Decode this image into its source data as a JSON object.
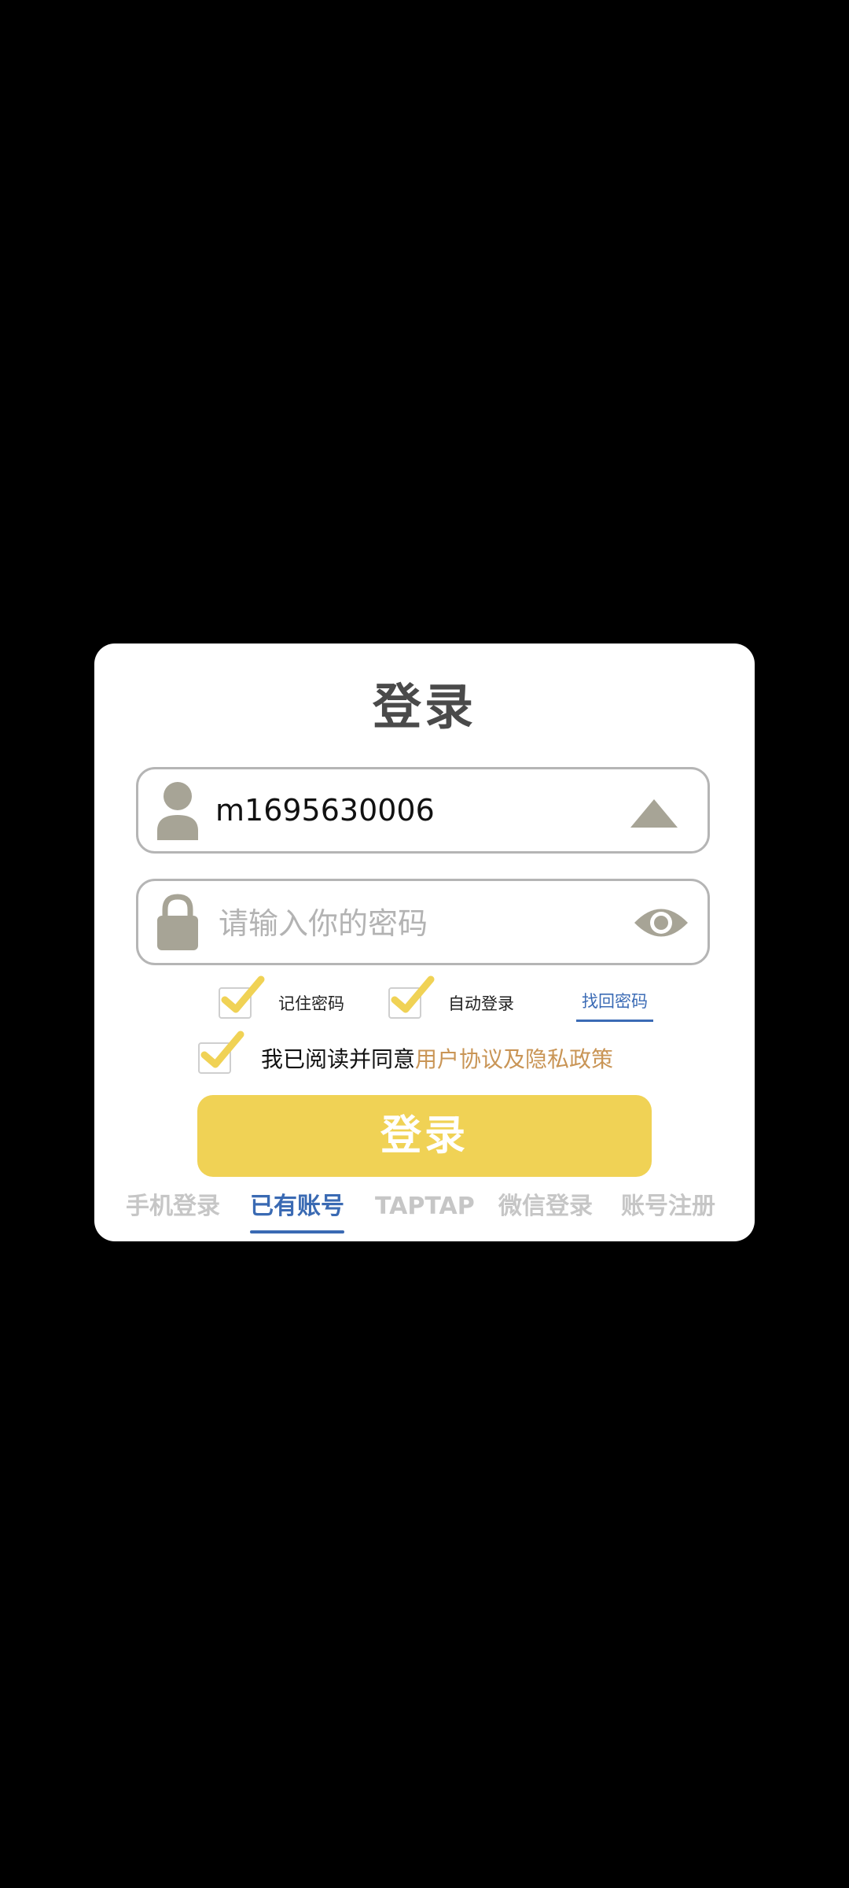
{
  "dialog": {
    "title": "登录",
    "username": {
      "value": "m1695630006"
    },
    "password": {
      "placeholder": "请输入你的密码"
    },
    "options": {
      "remember_password": "记住密码",
      "auto_login": "自动登录",
      "forgot_password": "找回密码"
    },
    "agreement": {
      "text": "我已阅读并同意",
      "link": "用户协议及隐私政策"
    },
    "login_button": "登录",
    "tabs": [
      "手机登录",
      "已有账号",
      "TAPTAP",
      "微信登录",
      "账号注册"
    ],
    "active_tab": "已有账号"
  },
  "colors": {
    "accent_yellow": "#f0d255",
    "link_blue": "#3a6ab3",
    "policy_link": "#c99556",
    "icon_gray": "#a7a496"
  },
  "icons": [
    "user-icon",
    "dropdown-arrow-icon",
    "lock-icon",
    "eye-icon",
    "checkmark-icon"
  ]
}
